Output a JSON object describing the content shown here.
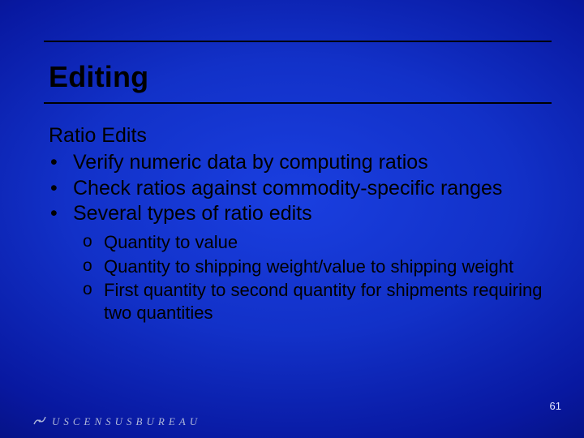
{
  "title": "Editing",
  "subhead": "Ratio Edits",
  "bullets": [
    {
      "text": "Verify numeric data by computing ratios"
    },
    {
      "text": "Check ratios against commodity-specific ranges"
    },
    {
      "text": "Several types of ratio edits"
    }
  ],
  "sub_bullets": [
    {
      "text": "Quantity to value"
    },
    {
      "text": "Quantity to shipping weight/value to shipping weight"
    },
    {
      "text": "First quantity to second quantity for shipments requiring two quantities"
    }
  ],
  "footer": {
    "org_text": "USCENSUSBUREAU",
    "page_number": "61"
  }
}
